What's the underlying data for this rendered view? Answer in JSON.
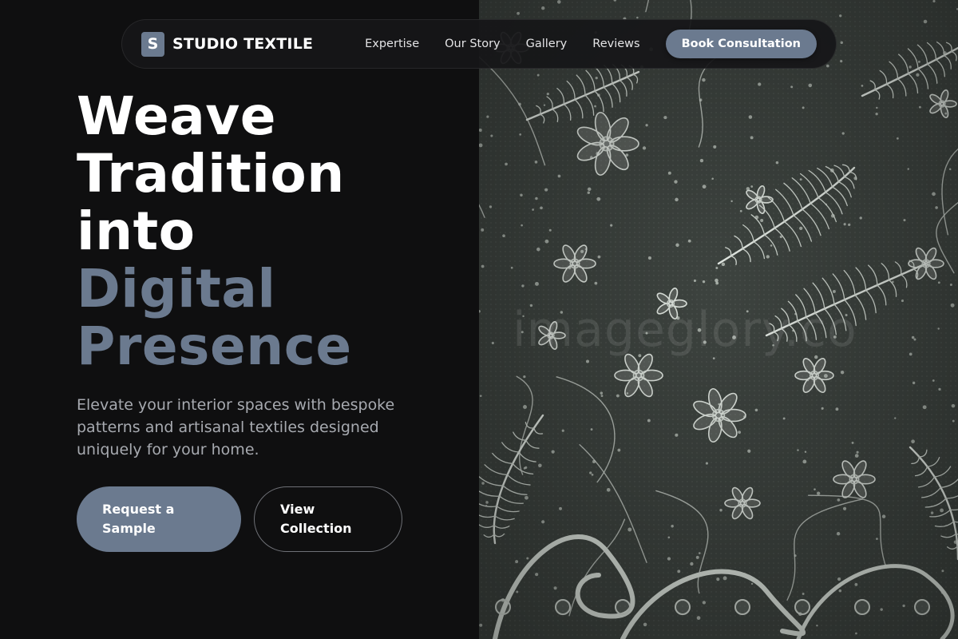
{
  "brand": {
    "mark": "S",
    "name": "STUDIO TEXTILE",
    "accent_color": "#6b7a8f"
  },
  "nav": {
    "links": [
      "Expertise",
      "Our Story",
      "Gallery",
      "Reviews"
    ],
    "cta": "Book Consultation"
  },
  "hero": {
    "title_lines": [
      "Weave",
      "Tradition",
      "into"
    ],
    "title_accent_lines": [
      "Digital",
      "Presence"
    ],
    "subtitle": "Elevate your interior spaces with bespoke patterns and artisanal textiles designed uniquely for your home.",
    "primary_cta": "Request a Sample",
    "secondary_cta": "View Collection"
  },
  "image": {
    "watermark": "imageglory.co"
  }
}
